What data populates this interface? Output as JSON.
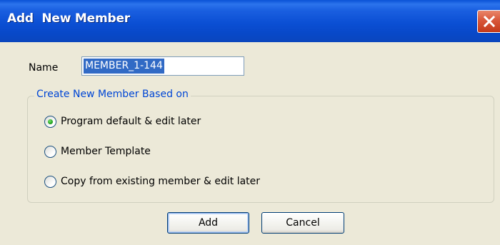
{
  "window": {
    "title": "Add  New Member",
    "close_icon": "close-icon"
  },
  "name_field": {
    "label": "Name",
    "value": "MEMBER_1-144",
    "selected": true
  },
  "group": {
    "legend": "Create New Member Based on",
    "options": [
      {
        "label": "Program default & edit later",
        "checked": true
      },
      {
        "label": "Member Template",
        "checked": false
      },
      {
        "label": "Copy from existing member & edit later",
        "checked": false
      }
    ]
  },
  "buttons": {
    "add_label": "Add",
    "cancel_label": "Cancel"
  },
  "colors": {
    "titlebar": "#0a52d6",
    "legend_text": "#0046d5",
    "selection": "#316ac5",
    "dialog_bg": "#ece9d8"
  }
}
